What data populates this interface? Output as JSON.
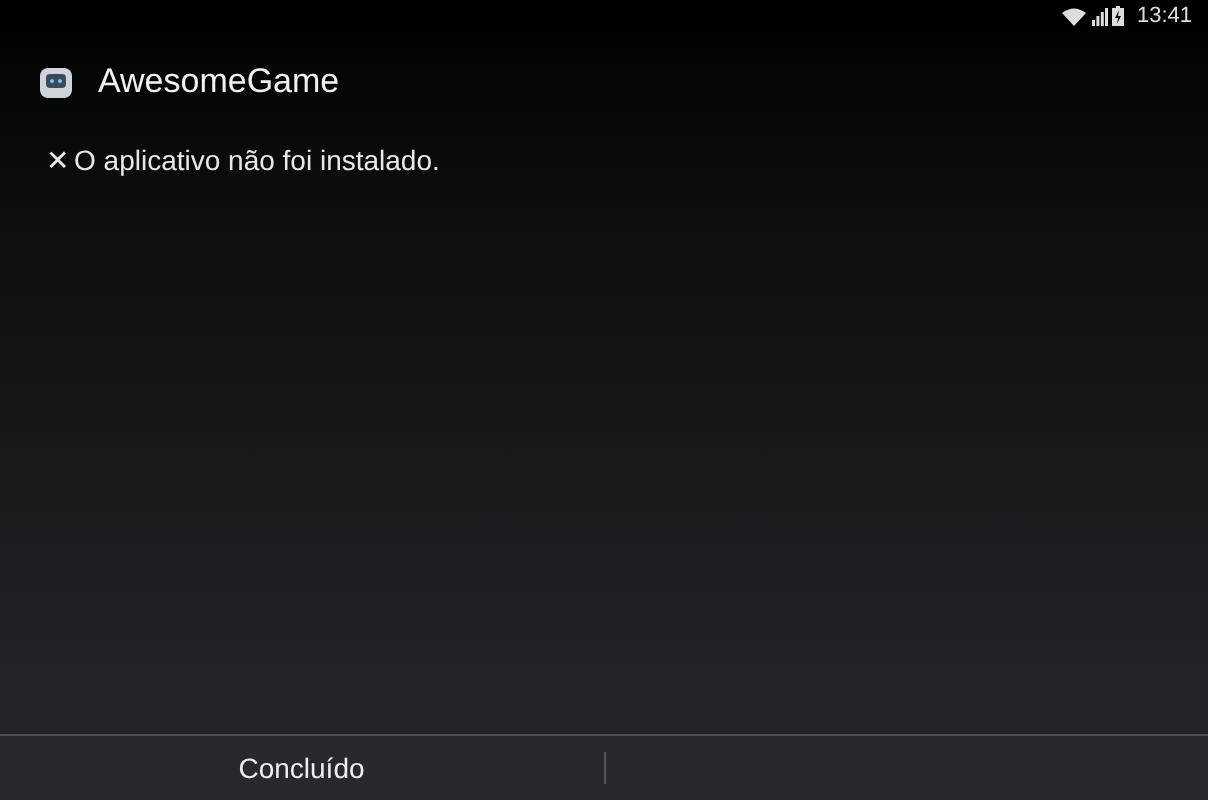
{
  "status_bar": {
    "time": "13:41"
  },
  "app": {
    "title": "AwesomeGame"
  },
  "message": {
    "icon": "✕",
    "text": "O aplicativo não foi instalado."
  },
  "buttons": [
    {
      "label": "Concluído"
    }
  ]
}
